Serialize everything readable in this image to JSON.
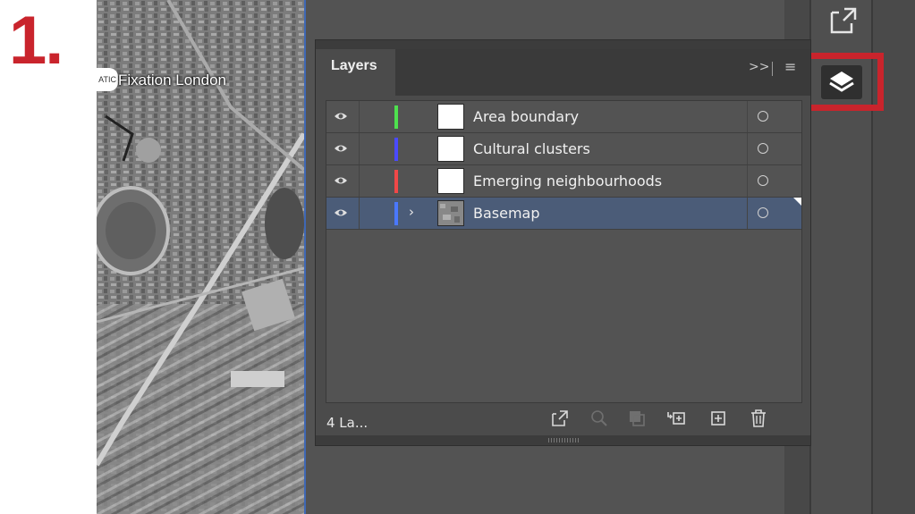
{
  "step": {
    "number": "1."
  },
  "map": {
    "place_label": "Fixation London",
    "badge_text": "ATIC"
  },
  "panel": {
    "tab_label": "Layers",
    "more_label": ">>",
    "menu_label": "≡",
    "layer_count": "4 La...",
    "layers": [
      {
        "name": "Area boundary",
        "color": "#4ee04e",
        "selected": false,
        "expandable": false,
        "thumb": "blank"
      },
      {
        "name": "Cultural clusters",
        "color": "#4a4aff",
        "selected": false,
        "expandable": false,
        "thumb": "blank"
      },
      {
        "name": "Emerging neighbourhoods",
        "color": "#f04848",
        "selected": false,
        "expandable": false,
        "thumb": "blank"
      },
      {
        "name": "Basemap",
        "color": "#4a78ff",
        "selected": true,
        "expandable": true,
        "thumb": "map"
      }
    ],
    "footer_icons": [
      "export-icon",
      "locate-object-icon",
      "clipping-mask-icon",
      "create-sublayer-icon",
      "new-layer-icon",
      "delete-icon"
    ]
  },
  "dock": {
    "icons": [
      "expand-panels-icon",
      "layers-icon"
    ]
  },
  "colors": {
    "highlight": "#c9242c",
    "selected_row": "#4b5c78"
  }
}
